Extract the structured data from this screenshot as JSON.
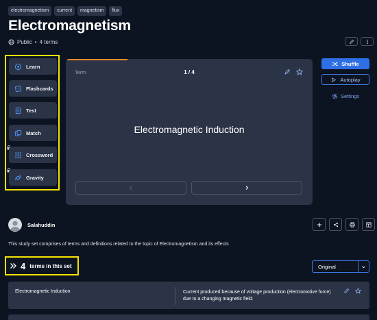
{
  "tags": [
    "electromagnetism",
    "current",
    "magnetism",
    "flux"
  ],
  "title": "Electromagnetism",
  "meta": {
    "visibility": "Public",
    "separator": "•",
    "term_count": "4 terms"
  },
  "modes": [
    {
      "label": "Learn",
      "icon": "learn-icon",
      "locked": false
    },
    {
      "label": "Flashcards",
      "icon": "flashcards-icon",
      "locked": false
    },
    {
      "label": "Test",
      "icon": "test-icon",
      "locked": false
    },
    {
      "label": "Match",
      "icon": "match-icon",
      "locked": false
    },
    {
      "label": "Crossword",
      "icon": "crossword-icon",
      "locked": true
    },
    {
      "label": "Gravity",
      "icon": "gravity-icon",
      "locked": true
    }
  ],
  "flashcard": {
    "side_label": "Term",
    "position": "1 / 4",
    "progress": 0.25,
    "word": "Electromagnetic Induction"
  },
  "controls": {
    "shuffle": "Shuffle",
    "autoplay": "Autoplay",
    "settings": "Settings"
  },
  "author": {
    "name": "Salahuddin"
  },
  "description": "This study set comprises of terms and definitions related to the topic of Electromagnetism and its effects",
  "terms_header": {
    "count": "4",
    "label": "terms in this set"
  },
  "sort": {
    "selected": "Original"
  },
  "terms": [
    {
      "term": "Electromagnetic Induction",
      "definition": "Current produced because of voltage production (electromotive force) due to a changing magnetic field."
    }
  ],
  "colors": {
    "background": "#0d1421",
    "panel": "#2b3446",
    "accent": "#2f6fe6",
    "highlight": "#f5e400",
    "progress": "#f08a24"
  }
}
